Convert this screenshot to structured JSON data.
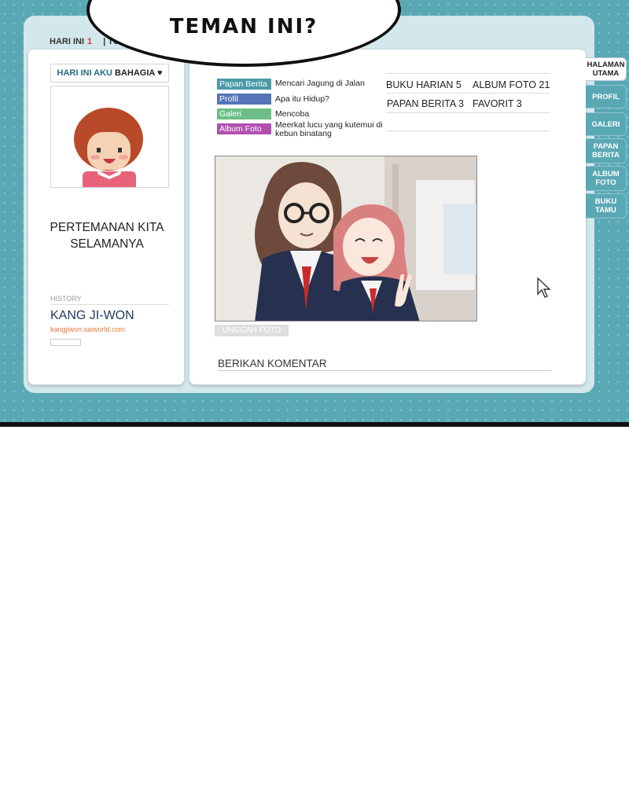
{
  "bubble": {
    "text": "TEMAN INI?"
  },
  "counter": {
    "today_label": "HARI INI",
    "today_value": "1",
    "total_label": "TOTAL"
  },
  "left_panel": {
    "mood_label": "HARI INI AKU",
    "mood_value": "BAHAGIA ♥",
    "title_line1": "PERTEMANAN KITA",
    "title_line2": "SELAMANYA",
    "history_label": "HISTORY",
    "owner_name": "KANG JI-WON",
    "owner_url": "kangjiwon.saiworld.com"
  },
  "news": [
    {
      "tag": "Papan Berita",
      "color": "#4a9aa8",
      "text": "Mencari Jagung di Jalan"
    },
    {
      "tag": "Profil",
      "color": "#5574b8",
      "text": "Apa itu Hidup?"
    },
    {
      "tag": "Galeri",
      "color": "#6cbf86",
      "text": "Mencoba"
    },
    {
      "tag": "Album Foto",
      "color": "#b24fb0",
      "text": "Meerkat lucu yang kutemui di kebun binatang"
    }
  ],
  "stats": {
    "diary": "BUKU HARIAN 5",
    "album": "ALBUM FOTO 21",
    "board": "PAPAN BERITA 3",
    "fav": "FAVORIT 3"
  },
  "upload_label": "UNGGAH FOTO",
  "comment_label": "BERIKAN KOMENTAR",
  "tabs": [
    {
      "label1": "HALAMAN",
      "label2": "UTAMA"
    },
    {
      "label1": "PROFIL",
      "label2": ""
    },
    {
      "label1": "GALERI",
      "label2": ""
    },
    {
      "label1": "PAPAN",
      "label2": "BERITA"
    },
    {
      "label1": "ALBUM",
      "label2": "FOTO"
    },
    {
      "label1": "BUKU",
      "label2": "TAMU"
    }
  ],
  "colors": {
    "teal": "#5aa8b4",
    "frame": "#d3e8ec"
  }
}
